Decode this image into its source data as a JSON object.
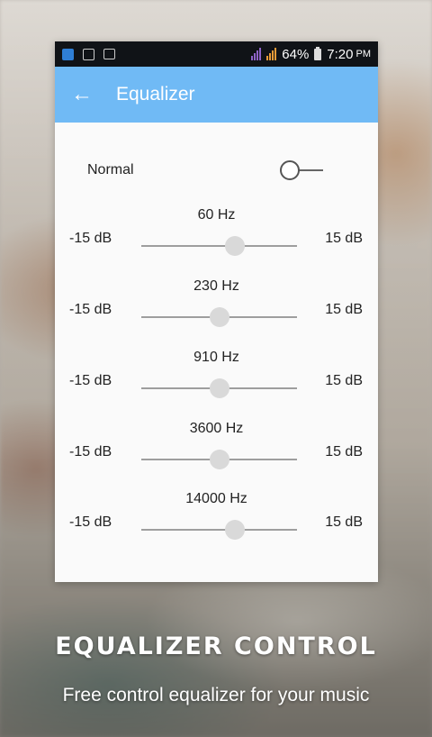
{
  "status_bar": {
    "battery": "64%",
    "time": "7:20",
    "ampm": "PM",
    "icons": [
      "play-store-icon",
      "image-icon",
      "message-icon",
      "signal-icon",
      "signal-icon",
      "battery-icon"
    ]
  },
  "app_bar": {
    "title": "Equalizer",
    "back_icon": "arrow-left-icon",
    "color": "#70baf5"
  },
  "preset": {
    "label": "Normal",
    "enabled": false
  },
  "bands": [
    {
      "freq": "60 Hz",
      "min": "-15 dB",
      "max": "15 dB",
      "level": 0.6
    },
    {
      "freq": "230 Hz",
      "min": "-15 dB",
      "max": "15 dB",
      "level": 0.5
    },
    {
      "freq": "910 Hz",
      "min": "-15 dB",
      "max": "15 dB",
      "level": 0.5
    },
    {
      "freq": "3600 Hz",
      "min": "-15 dB",
      "max": "15 dB",
      "level": 0.5
    },
    {
      "freq": "14000 Hz",
      "min": "-15 dB",
      "max": "15 dB",
      "level": 0.6
    }
  ],
  "caption": {
    "title": "EQUALIZER CONTROL",
    "subtitle": "Free control equalizer for your music"
  }
}
